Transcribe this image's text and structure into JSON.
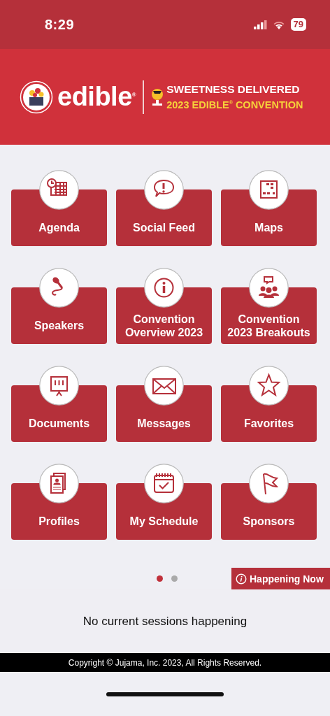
{
  "status_bar": {
    "time": "8:29",
    "battery": "79"
  },
  "banner": {
    "brand": "edible$^{®}$",
    "headline": "SWEETNESS DELIVERED",
    "subline": "2023 EDIBLE$^{®}$ CONVENTION"
  },
  "tiles": [
    {
      "label": "Agenda"
    },
    {
      "label": "Social Feed"
    },
    {
      "label": "Maps"
    },
    {
      "label": "Speakers"
    },
    {
      "label": "Convention Overview 2023"
    },
    {
      "label": "Convention 2023 Breakouts"
    },
    {
      "label": "Documents"
    },
    {
      "label": "Messages"
    },
    {
      "label": "Favorites"
    },
    {
      "label": "Profiles"
    },
    {
      "label": "My Schedule"
    },
    {
      "label": "Sponsors"
    }
  ],
  "pages": [
    {
      "selected": true
    },
    {
      "selected": false
    }
  ],
  "happening_now": {
    "label": "Happening Now",
    "message": "No current sessions happening"
  },
  "footer": "Copyright © Jujama, Inc. 2023, All Rights Reserved."
}
